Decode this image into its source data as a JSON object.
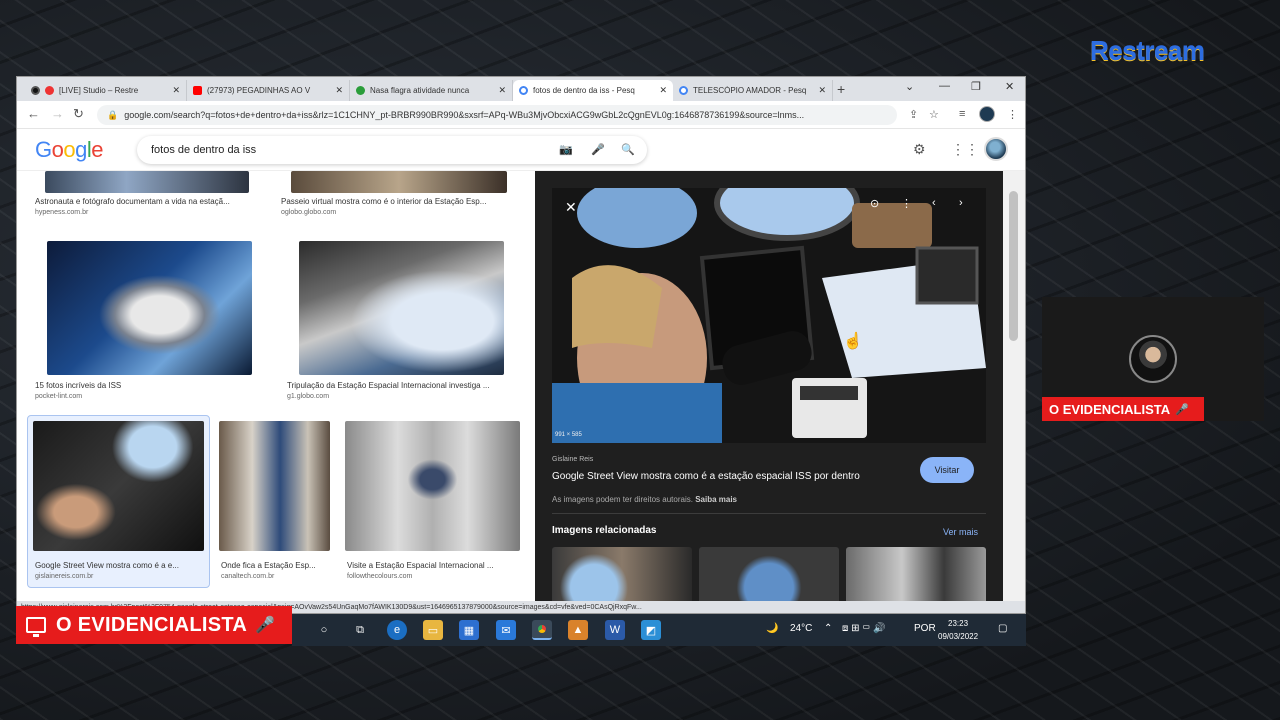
{
  "overlay": {
    "brand": "Restream",
    "channel_banner": "O EVIDENCIALISTA",
    "cam_banner": "O EVIDENCIALISTA"
  },
  "browser": {
    "tabs": [
      {
        "label": "[LIVE] Studio – Restre",
        "fav_color": "#111111"
      },
      {
        "label": "(27973) PEGADINHAS AO V",
        "fav_color": "#ff0000"
      },
      {
        "label": "Nasa flagra atividade nunca",
        "fav_color": "#2a9d3a"
      },
      {
        "label": "fotos de dentro da iss - Pesq",
        "fav_color": "#4285f4"
      },
      {
        "label": "TELESCÓPIO AMADOR - Pesq",
        "fav_color": "#4285f4"
      }
    ],
    "url": "google.com/search?q=fotos+de+dentro+da+iss&rlz=1C1CHNY_pt-BRBR990BR990&sxsrf=APq-WBu3MjvObcxiACG9wGbL2cQgnEVL0g:1646878736199&source=lnms...",
    "status_url": "https://www.gislainereis.com.br%2Fpost%2F9754-google-street-estacao-espacial&psig=AOvVaw2s54UnGaqMo7fAWIK130D9&ust=1646965137879000&source=images&cd=vfe&ved=0CAsQjRxqFw..."
  },
  "google": {
    "logo": [
      "G",
      "o",
      "o",
      "g",
      "l",
      "e"
    ],
    "query": "fotos de dentro da iss"
  },
  "results": [
    {
      "caption": "Astronauta e fotógrafo documentam a vida na estaçã...",
      "source": "hypeness.com.br"
    },
    {
      "caption": "Passeio virtual mostra como é o interior da Estação Esp...",
      "source": "oglobo.globo.com"
    },
    {
      "caption": "15 fotos incríveis da ISS",
      "source": "pocket-lint.com"
    },
    {
      "caption": "Tripulação da Estação Espacial Internacional investiga ...",
      "source": "g1.globo.com"
    },
    {
      "caption": "Google Street View mostra como é a e...",
      "source": "gislainereis.com.br"
    },
    {
      "caption": "Onde fica a Estação Esp...",
      "source": "canaltech.com.br"
    },
    {
      "caption": "Visite a Estação Espacial Internacional ...",
      "source": "followthecolours.com"
    }
  ],
  "preview": {
    "image_size": "991 × 585",
    "site": "Gislaine Reis",
    "title": "Google Street View mostra como é a estação espacial ISS por dentro",
    "visit_label": "Visitar",
    "rights_text": "As imagens podem ter direitos autorais.",
    "learn_more": "Saiba mais",
    "related_label": "Imagens relacionadas",
    "see_more": "Ver mais"
  },
  "taskbar": {
    "weather": "24°C",
    "language": "POR",
    "time": "23:23",
    "date": "09/03/2022"
  }
}
